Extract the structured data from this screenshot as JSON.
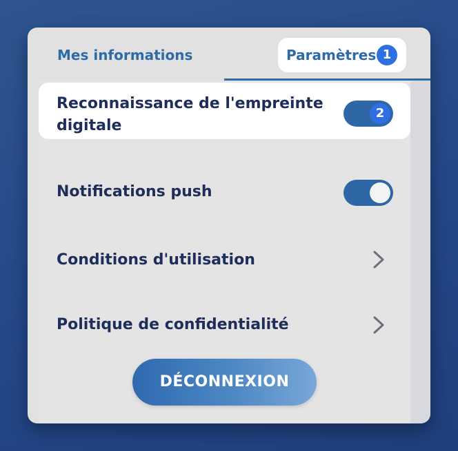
{
  "tabs": {
    "mes_informations": "Mes informations",
    "parametres": "Paramètres"
  },
  "badges": {
    "first": "1",
    "second": "2"
  },
  "settings": {
    "fingerprint": {
      "label": "Reconnaissance de l'empreinte digitale",
      "enabled": true
    },
    "push": {
      "label": "Notifications push",
      "enabled": true
    },
    "terms": {
      "label": "Conditions d'utilisation",
      "icon": "chevron-right-icon"
    },
    "privacy": {
      "label": "Politique de confidentialité",
      "icon": "chevron-right-icon"
    }
  },
  "logout_label": "DÉCONNEXION",
  "colors": {
    "accent": "#2e6ba6",
    "badge": "#2f6fe2",
    "text": "#1e2d5a",
    "background": "#24488a"
  }
}
